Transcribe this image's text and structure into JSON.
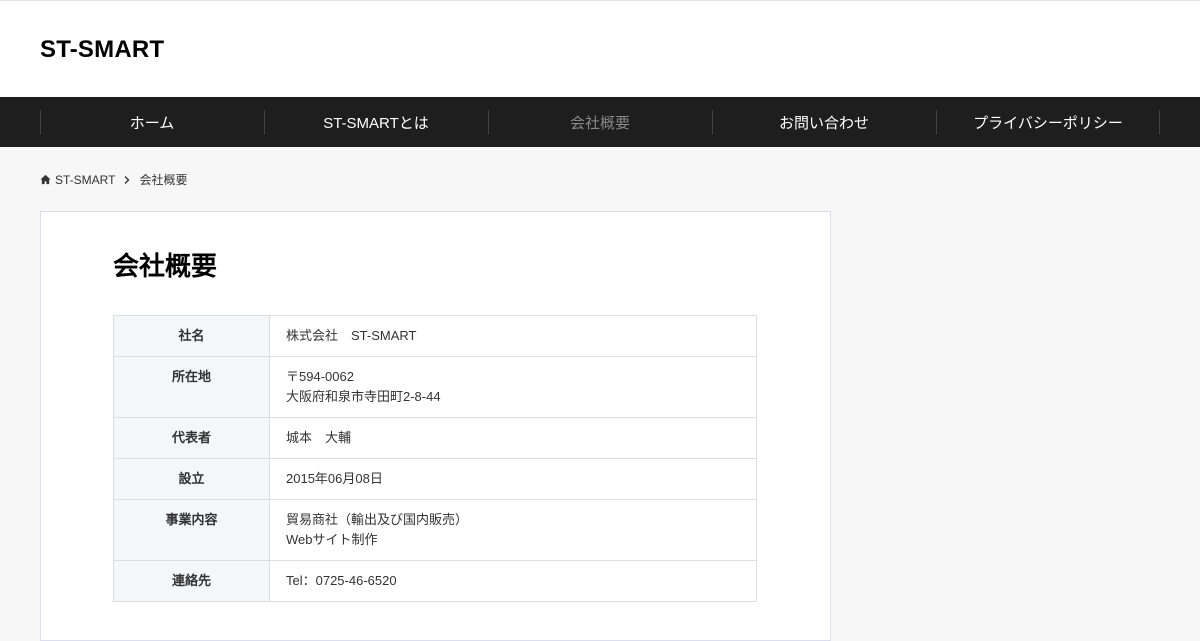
{
  "site": {
    "title": "ST-SMART"
  },
  "nav": {
    "items": [
      {
        "label": "ホーム"
      },
      {
        "label": "ST-SMARTとは"
      },
      {
        "label": "会社概要"
      },
      {
        "label": "お問い合わせ"
      },
      {
        "label": "プライバシーポリシー"
      }
    ]
  },
  "breadcrumb": {
    "home": "ST-SMART",
    "current": "会社概要"
  },
  "page": {
    "title": "会社概要"
  },
  "company_table": {
    "rows": [
      {
        "label": "社名",
        "lines": [
          "株式会社　ST-SMART"
        ]
      },
      {
        "label": "所在地",
        "lines": [
          "〒594-0062",
          "大阪府和泉市寺田町2-8-44"
        ]
      },
      {
        "label": "代表者",
        "lines": [
          "城本　大輔"
        ]
      },
      {
        "label": "設立",
        "lines": [
          "2015年06月08日"
        ]
      },
      {
        "label": "事業内容",
        "lines": [
          "貿易商社（輸出及び国内販売）",
          "Webサイト制作"
        ]
      },
      {
        "label": "連絡先",
        "lines": [
          "Tel：0725-46-6520"
        ]
      }
    ]
  },
  "colors": {
    "nav_bg": "#1e1e1e",
    "nav_current": "#888888",
    "page_bg": "#f7f7f7"
  }
}
